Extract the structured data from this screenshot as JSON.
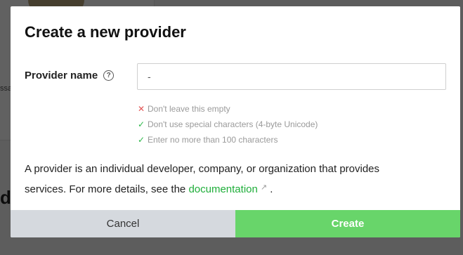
{
  "background": {
    "partial_text_small": "ssa",
    "partial_text_big": "de"
  },
  "modal": {
    "title": "Create a new provider",
    "field": {
      "label": "Provider name",
      "help_icon": "question-circle-icon",
      "value": "-",
      "placeholder": ""
    },
    "rules": [
      {
        "status": "fail",
        "icon": "x-icon",
        "text": "Don't leave this empty"
      },
      {
        "status": "pass",
        "icon": "check-icon",
        "text": "Don't use special characters (4-byte Unicode)"
      },
      {
        "status": "pass",
        "icon": "check-icon",
        "text": "Enter no more than 100 characters"
      }
    ],
    "description": {
      "text_before": "A provider is an individual developer, company, or organization that provides services. For more details, see the ",
      "link_text": "documentation",
      "link_icon": "external-link-icon",
      "text_after": " ."
    },
    "buttons": {
      "cancel": "Cancel",
      "create": "Create"
    }
  },
  "colors": {
    "accent_green": "#68d56a",
    "link_green": "#1fae3a",
    "fail_red": "#e25555",
    "pass_green": "#2db84a",
    "cancel_gray": "#d5d9de"
  }
}
